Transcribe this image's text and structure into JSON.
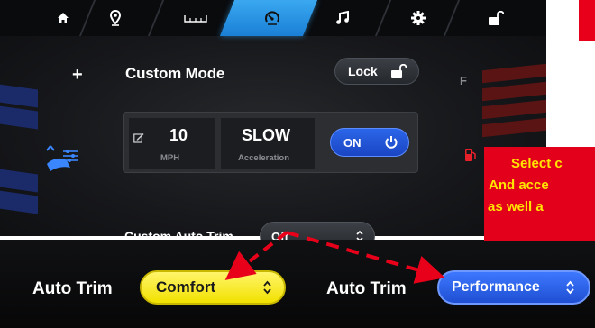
{
  "tabs": [
    {
      "name": "home",
      "icon": "home-icon"
    },
    {
      "name": "location",
      "icon": "location-pin-icon"
    },
    {
      "name": "trim",
      "icon": "trim-gauge-icon"
    },
    {
      "name": "cruise",
      "icon": "speedometer-icon",
      "active": true
    },
    {
      "name": "audio",
      "icon": "music-note-icon"
    },
    {
      "name": "settings",
      "icon": "gear-icon"
    },
    {
      "name": "lock",
      "icon": "unlock-icon"
    }
  ],
  "mode": {
    "plus": "+",
    "title": "Custom Mode",
    "lock_label": "Lock"
  },
  "gauge": {
    "fuel_label": "F"
  },
  "speed": {
    "value": "10",
    "unit": "MPH",
    "accel_value": "SLOW",
    "accel_label": "Acceleration",
    "toggle_label": "ON"
  },
  "custom_auto_trim": {
    "label": "Custom Auto Trim",
    "value": "Off"
  },
  "bottom": {
    "left_label": "Auto Trim",
    "left_value": "Comfort",
    "right_label": "Auto Trim",
    "right_value": "Performance"
  },
  "callout": {
    "lines": [
      "Select c",
      "And acce",
      "as well a"
    ]
  },
  "colors": {
    "active_tab": "#2a92e6",
    "accent_blue": "#2356dc",
    "comfort_yellow": "#f5e400",
    "callout_red": "#e3001b",
    "callout_text": "#ffe600",
    "arrow_red": "#e8001a"
  }
}
